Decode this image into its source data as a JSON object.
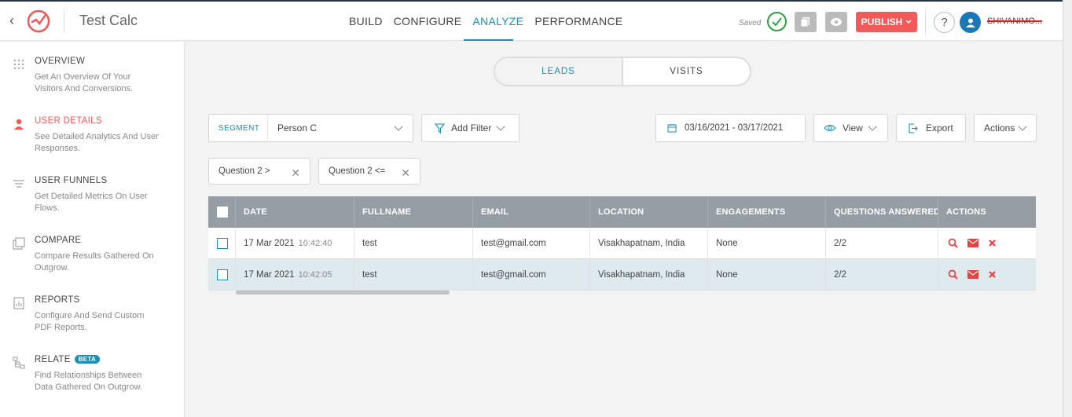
{
  "app": {
    "title": "Test Calc"
  },
  "nav": {
    "items": [
      "BUILD",
      "CONFIGURE",
      "ANALYZE",
      "PERFORMANCE"
    ],
    "active": "ANALYZE"
  },
  "header": {
    "saved_text": "Saved",
    "publish_label": "PUBLISH",
    "help_label": "?",
    "username": "SHIVANIMO..."
  },
  "sidebar": {
    "items": [
      {
        "title": "OVERVIEW",
        "desc": "Get An Overview Of Your Visitors And Conversions.",
        "icon": "grid-dots-icon"
      },
      {
        "title": "USER DETAILS",
        "desc": "See Detailed Analytics And User Responses.",
        "icon": "user-icon",
        "active": true
      },
      {
        "title": "USER FUNNELS",
        "desc": "Get Detailed Metrics On User Flows.",
        "icon": "funnel-lines-icon"
      },
      {
        "title": "COMPARE",
        "desc": "Compare Results Gathered On Outgrow.",
        "icon": "compare-icon"
      },
      {
        "title": "REPORTS",
        "desc": "Configure And Send Custom PDF Reports.",
        "icon": "report-icon"
      },
      {
        "title": "RELATE",
        "badge": "BETA",
        "desc": "Find Relationships Between Data Gathered On Outgrow.",
        "icon": "relate-icon"
      }
    ]
  },
  "toggle": {
    "leads": "LEADS",
    "visits": "VISITS",
    "active": "LEADS"
  },
  "toolbar": {
    "segment_label": "SEGMENT",
    "segment_value": "Person C",
    "add_filter": "Add Filter",
    "date_range": "03/16/2021 - 03/17/2021",
    "view": "View",
    "export": "Export",
    "actions": "Actions"
  },
  "filters": [
    "Question 2 >",
    "Question 2 <="
  ],
  "table": {
    "columns": [
      "DATE",
      "FULLNAME",
      "EMAIL",
      "LOCATION",
      "ENGAGEMENTS",
      "QUESTIONS ANSWERED",
      "ACTIONS"
    ],
    "rows": [
      {
        "date": "17 Mar 2021",
        "time": "10:42:40",
        "fullname": "test",
        "email": "test@gmail.com",
        "location": "Visakhapatnam, India",
        "engagements": "None",
        "answered": "2/2"
      },
      {
        "date": "17 Mar 2021",
        "time": "10:42:05",
        "fullname": "test",
        "email": "test@gmail.com",
        "location": "Visakhapatnam, India",
        "engagements": "None",
        "answered": "2/2"
      }
    ]
  },
  "colors": {
    "accent": "#1b8fba",
    "danger": "#f25a5a",
    "header_bg": "#959ea4",
    "row_alt": "#deeaee"
  }
}
